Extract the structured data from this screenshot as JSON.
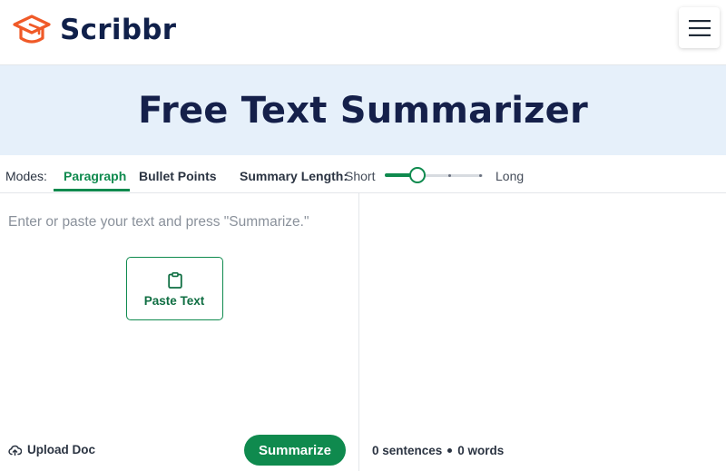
{
  "header": {
    "brand": "Scribbr",
    "logo_icon": "graduation-cap-icon",
    "menu_icon": "hamburger-menu-icon"
  },
  "hero": {
    "title": "Free Text Summarizer"
  },
  "modes": {
    "label": "Modes:",
    "tabs": [
      {
        "label": "Paragraph",
        "active": true
      },
      {
        "label": "Bullet Points",
        "active": false
      }
    ],
    "summary_length": {
      "label": "Summary Length:",
      "min_label": "Short",
      "max_label": "Long",
      "value_fraction": 0.33
    }
  },
  "input": {
    "placeholder": "Enter or paste your text and press \"Summarize.\"",
    "paste_button_label": "Paste Text",
    "paste_icon": "clipboard-icon",
    "upload_label": "Upload Doc",
    "upload_icon": "cloud-upload-icon",
    "summarize_label": "Summarize"
  },
  "output": {
    "sentences": "0 sentences",
    "words": "0 words"
  },
  "colors": {
    "brand_green": "#0f8a4e",
    "logo_orange": "#f05a28",
    "navy": "#15204a",
    "hero_bg": "#e6f0fa"
  }
}
